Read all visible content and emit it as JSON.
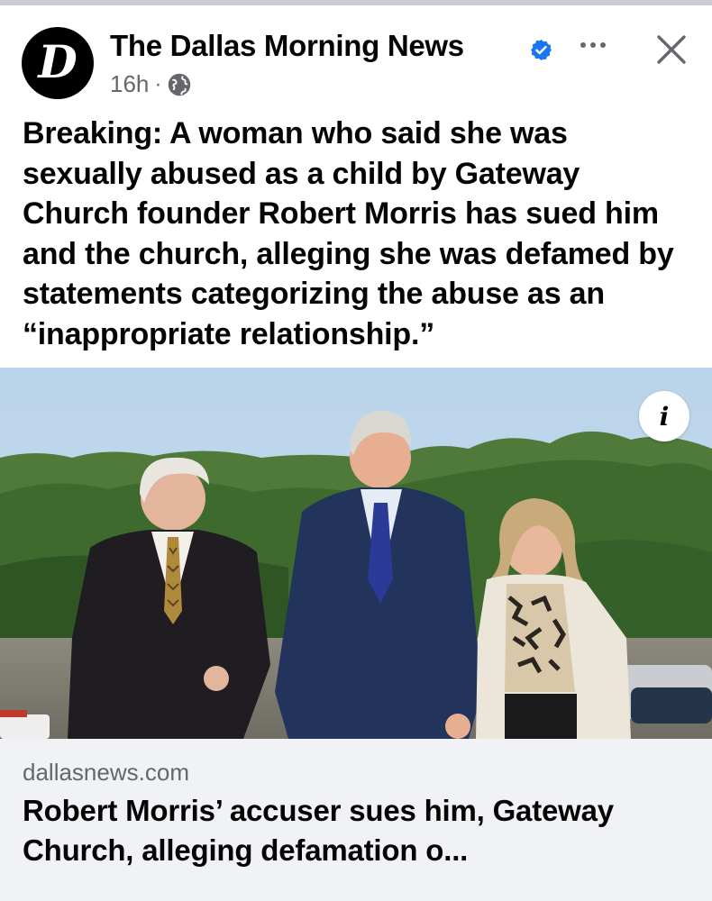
{
  "post": {
    "page_name": "The Dallas Morning News",
    "avatar_letter": "D",
    "time": "16h",
    "separator": "·",
    "audience_icon": "globe-icon",
    "verified_icon": "verified-badge-icon",
    "text": "Breaking: A woman who said she was sexually abused as a child by Gateway Church founder Robert Morris has sued him and the church, alleging she was defamed by statements categorizing the abuse as an “inappropriate relationship.”"
  },
  "photo": {
    "info_label": "i"
  },
  "link": {
    "domain": "dallasnews.com",
    "title": "Robert Morris’ accuser sues him, Gateway Church, alleging defamation o..."
  },
  "colors": {
    "verified": "#1877f2",
    "secondary_text": "#65676b",
    "link_bg": "#f0f2f5"
  }
}
